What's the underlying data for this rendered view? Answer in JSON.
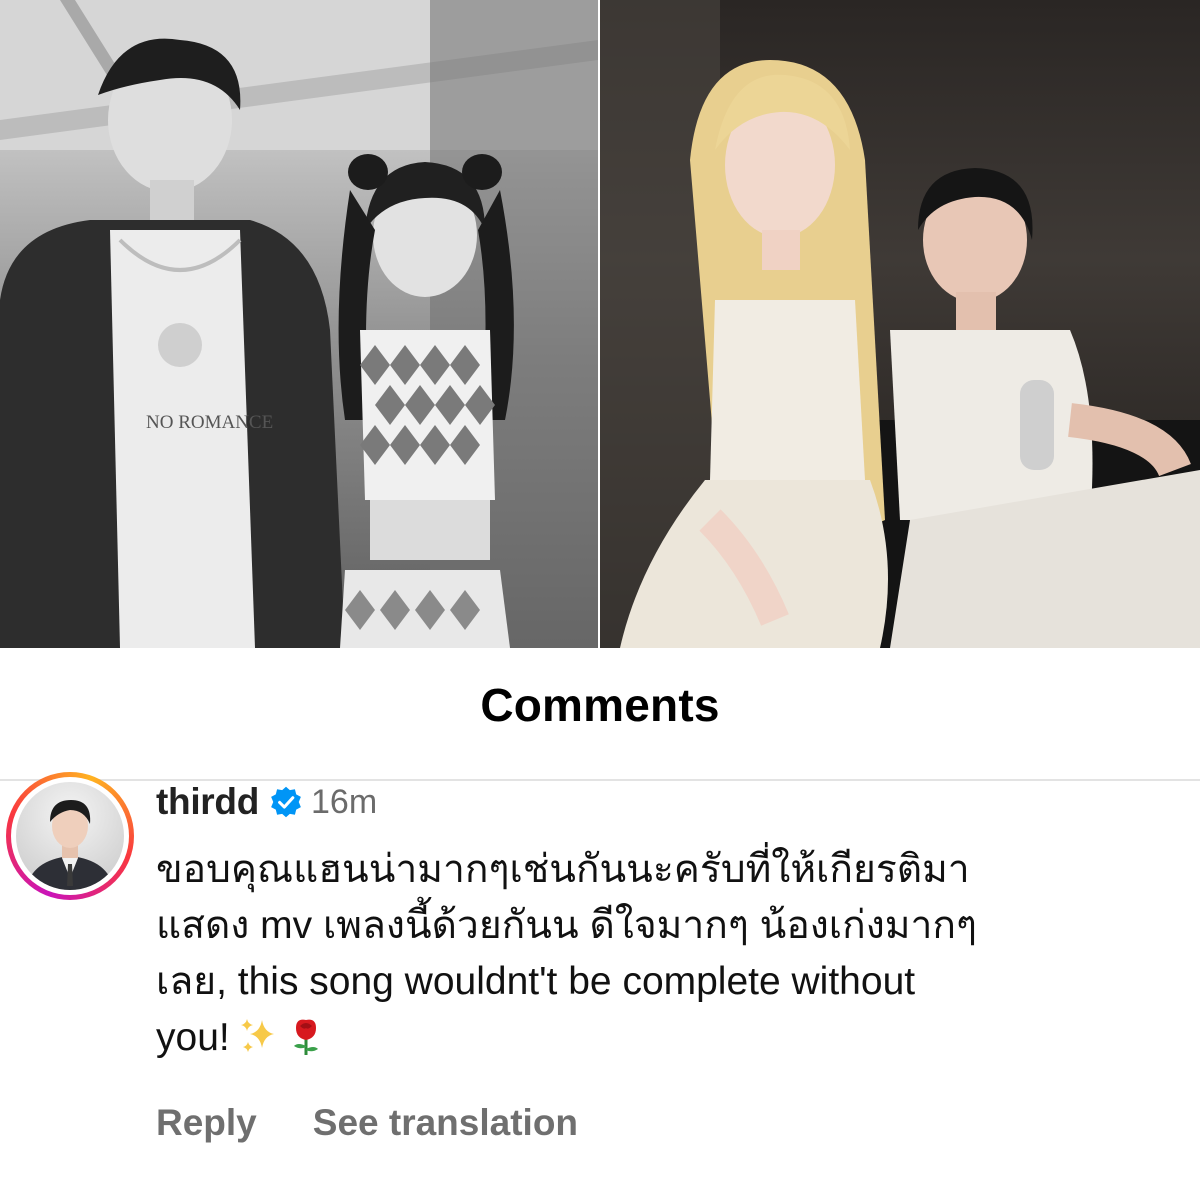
{
  "section": {
    "title": "Comments"
  },
  "comment": {
    "username": "thirdd",
    "verified": true,
    "time": "16m",
    "lines": [
      "ขอบคุณแฮนน่ามากๆเช่นกันนะครับที่ให้เกียรติมา",
      "แสดง mv เพลงนี้ด้วยกันน ดีใจมากๆ น้องเก่งมากๆ",
      "เลย, this song wouldnt't be complete without",
      "you!"
    ],
    "emojis": [
      "sparkles-icon",
      "rose-icon"
    ],
    "actions": {
      "reply": "Reply",
      "see_translation": "See translation"
    }
  },
  "photo_text": {
    "shirt_print": "NO ROMANCE"
  },
  "colors": {
    "verified_badge": "#0095f6",
    "action_text": "#6f6f6f",
    "time_text": "#6b6b6b"
  }
}
